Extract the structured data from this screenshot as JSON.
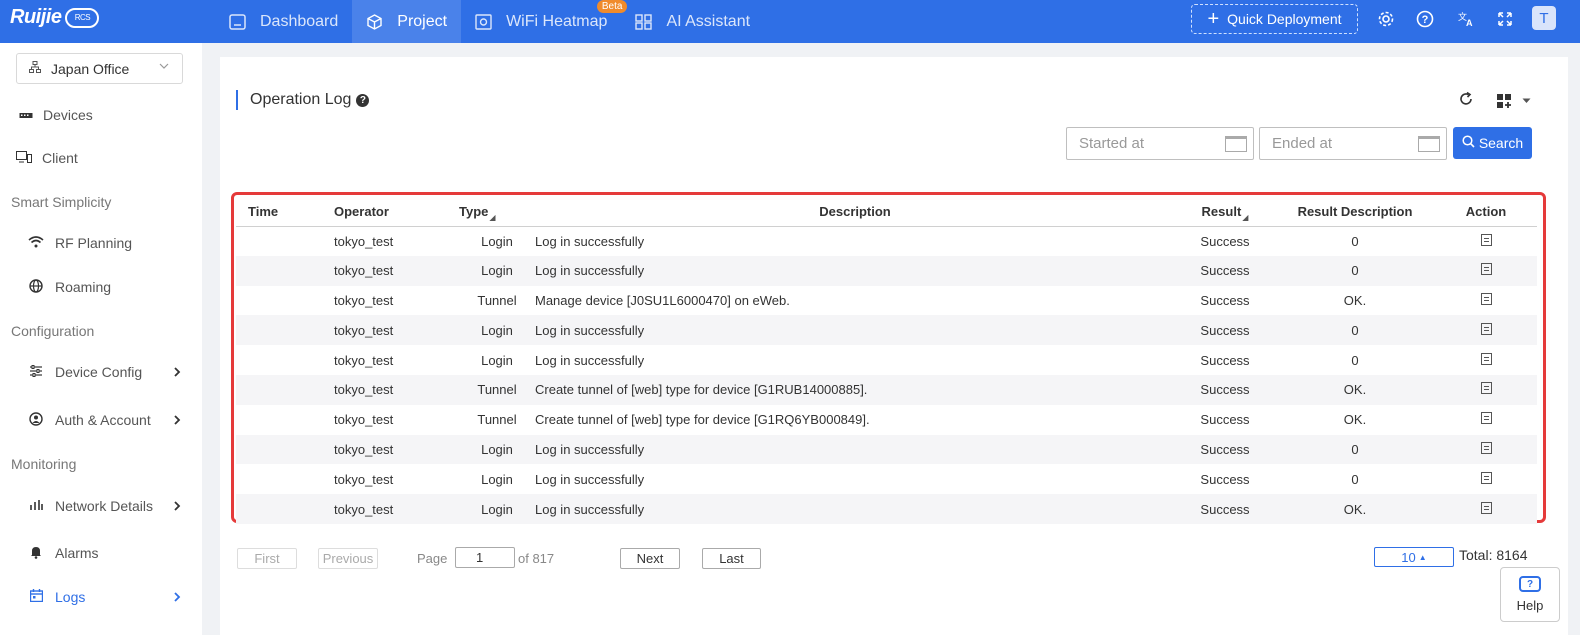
{
  "brand": {
    "logo_text": "Ruijie",
    "badge": "RCS"
  },
  "nav": {
    "items": [
      {
        "label": "Dashboard"
      },
      {
        "label": "Project"
      },
      {
        "label": "WiFi Heatmap",
        "badge": "Beta"
      },
      {
        "label": "AI Assistant"
      }
    ],
    "quick_deployment": "Quick Deployment",
    "avatar": "T"
  },
  "sidebar": {
    "site": "Japan Office",
    "items": [
      {
        "label": "Devices"
      },
      {
        "label": "Client"
      }
    ],
    "sections": [
      "Smart Simplicity",
      "Configuration",
      "Monitoring"
    ],
    "smart": [
      {
        "label": "RF Planning"
      },
      {
        "label": "Roaming"
      }
    ],
    "config": [
      {
        "label": "Device Config"
      },
      {
        "label": "Auth & Account"
      }
    ],
    "monitor": [
      {
        "label": "Network Details"
      },
      {
        "label": "Alarms"
      },
      {
        "label": "Logs"
      }
    ]
  },
  "page": {
    "title": "Operation Log",
    "started_placeholder": "Started at",
    "ended_placeholder": "Ended at",
    "search_label": "Search"
  },
  "table": {
    "columns": [
      "Time",
      "Operator",
      "Type",
      "Description",
      "Result",
      "Result Description",
      "Action"
    ],
    "rows": [
      {
        "time": "",
        "operator": "tokyo_test",
        "type": "Login",
        "description": "Log in successfully",
        "result": "Success",
        "result_description": "0"
      },
      {
        "time": "",
        "operator": "tokyo_test",
        "type": "Login",
        "description": "Log in successfully",
        "result": "Success",
        "result_description": "0"
      },
      {
        "time": "",
        "operator": "tokyo_test",
        "type": "Tunnel",
        "description": "Manage device [J0SU1L6000470] on eWeb.",
        "result": "Success",
        "result_description": "OK."
      },
      {
        "time": "",
        "operator": "tokyo_test",
        "type": "Login",
        "description": "Log in successfully",
        "result": "Success",
        "result_description": "0"
      },
      {
        "time": "",
        "operator": "tokyo_test",
        "type": "Login",
        "description": "Log in successfully",
        "result": "Success",
        "result_description": "0"
      },
      {
        "time": "",
        "operator": "tokyo_test",
        "type": "Tunnel",
        "description": "Create tunnel of [web] type for device [G1RUB14000885].",
        "result": "Success",
        "result_description": "OK."
      },
      {
        "time": "",
        "operator": "tokyo_test",
        "type": "Tunnel",
        "description": "Create tunnel of [web] type for device [G1RQ6YB000849].",
        "result": "Success",
        "result_description": "OK."
      },
      {
        "time": "",
        "operator": "tokyo_test",
        "type": "Login",
        "description": "Log in successfully",
        "result": "Success",
        "result_description": "0"
      },
      {
        "time": "",
        "operator": "tokyo_test",
        "type": "Login",
        "description": "Log in successfully",
        "result": "Success",
        "result_description": "0"
      },
      {
        "time": "",
        "operator": "tokyo_test",
        "type": "Login",
        "description": "Log in successfully",
        "result": "Success",
        "result_description": "OK."
      }
    ]
  },
  "pagination": {
    "first": "First",
    "previous": "Previous",
    "page_label": "Page",
    "current_page": "1",
    "of_label": "of 817",
    "next": "Next",
    "last": "Last",
    "page_size": "10",
    "total_label": "Total: 8164"
  },
  "help_label": "Help",
  "colors": {
    "primary": "#2f6fe6",
    "highlight_frame": "#e53a3a",
    "beta_badge": "#f08b2c"
  }
}
